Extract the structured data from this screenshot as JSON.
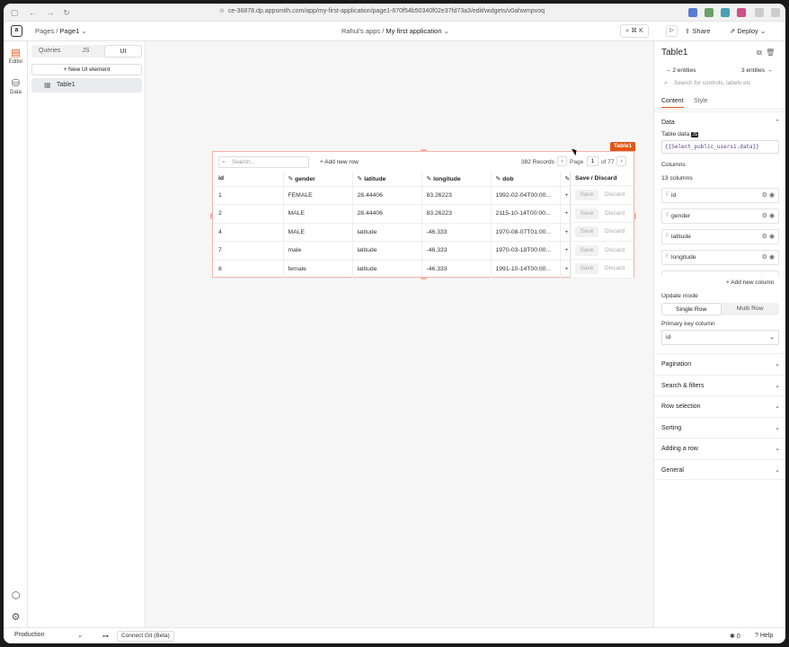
{
  "browser": {
    "url": "ce-36878.dp.appsmith.com/app/my-first-application/page1-670f54b50340f02e37fd73a3/edit/widgets/v0ahwmpvoq"
  },
  "topbar": {
    "logo": "a",
    "pages_label": "Pages",
    "page_name": "Page1",
    "workspace": "Rahul's apps",
    "app_name": "My first application",
    "cmdk": "⌘ K",
    "share": "Share",
    "deploy": "Deploy"
  },
  "rail": {
    "editor": "Editor",
    "data": "Data"
  },
  "explorer": {
    "tabs": [
      "Queries",
      "JS",
      "UI"
    ],
    "active_tab": "UI",
    "new_ui_element": "+ New UI element",
    "widgets": [
      "Table1"
    ]
  },
  "table_widget": {
    "name": "Table1",
    "search_placeholder": "Search...",
    "add_new_row": "+ Add new row",
    "records": "382 Records",
    "page_label": "Page",
    "page_current": "1",
    "page_total": "of 77",
    "columns": [
      "id",
      "gender",
      "latitude",
      "longitude",
      "dob",
      ""
    ],
    "rows": [
      [
        "1",
        "FEMALE",
        "28.44406",
        "83.26223",
        "1992-02-04T00:00...",
        "+"
      ],
      [
        "2",
        "MALE",
        "28.44406",
        "83.26223",
        "2115-10-14T00:00...",
        "+"
      ],
      [
        "4",
        "MALE",
        "latitude",
        "-46.333",
        "1970-08-07T01:00...",
        "+"
      ],
      [
        "7",
        "male",
        "latitude",
        "-46.333",
        "1970-03-18T00:00...",
        "+"
      ],
      [
        "8",
        "female",
        "latitude",
        "-46.333",
        "1991-10-14T00:00...",
        "+"
      ]
    ],
    "save_discard_header": "Save / Discard",
    "save_label": "Save",
    "discard_label": "Discard"
  },
  "properties": {
    "title": "Table1",
    "entities_left": "2 entities",
    "entities_right": "3 entities",
    "search_placeholder": "Search for controls, labels etc",
    "tabs": [
      "Content",
      "Style"
    ],
    "active_tab": "Content",
    "data_section": "Data",
    "table_data_label": "Table data",
    "table_data_value": "{{Select_public_users1.data}}",
    "columns_label": "Columns",
    "columns_count": "13 columns",
    "column_items": [
      "id",
      "gender",
      "latitude",
      "longitude"
    ],
    "add_new_column": "+ Add new column",
    "update_mode_label": "Update mode",
    "update_modes": [
      "Single Row",
      "Multi Row"
    ],
    "update_mode_selected": "Single Row",
    "primary_key_label": "Primary key column",
    "primary_key_value": "id",
    "sections": [
      "Pagination",
      "Search & filters",
      "Row selection",
      "Sorting",
      "Adding a row",
      "General"
    ]
  },
  "bottombar": {
    "environment": "Production",
    "connect_git": "Connect Git (Beta)",
    "errors_count": "0",
    "help": "Help"
  },
  "colors": {
    "accent": "#e15615",
    "widget_border": "#f2b3a8",
    "canvas_bg": "#f6f6f6"
  }
}
